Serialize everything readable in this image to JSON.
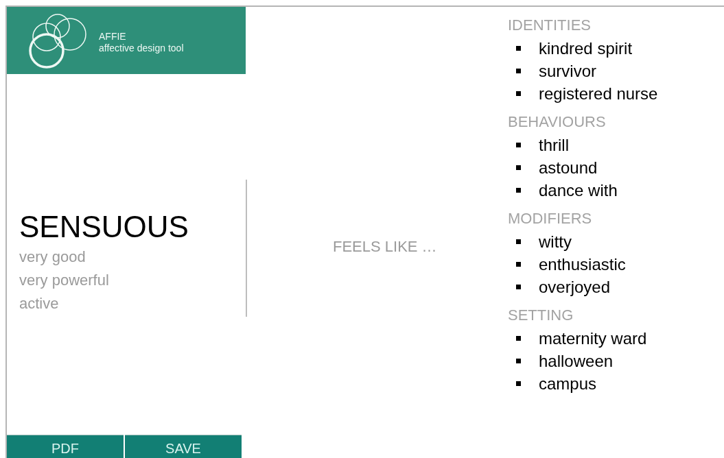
{
  "header": {
    "title": "AFFIE",
    "subtitle": "affective design tool"
  },
  "emotion": {
    "name": "SENSUOUS",
    "qualities": [
      "very good",
      "very powerful",
      "active"
    ]
  },
  "feels_like": "FEELS LIKE …",
  "sections": [
    {
      "title": "IDENTITIES",
      "items": [
        "kindred spirit",
        "survivor",
        "registered nurse"
      ]
    },
    {
      "title": "BEHAVIOURS",
      "items": [
        "thrill",
        "astound",
        "dance with"
      ]
    },
    {
      "title": "MODIFIERS",
      "items": [
        "witty",
        "enthusiastic",
        "overjoyed"
      ]
    },
    {
      "title": "SETTING",
      "items": [
        "maternity ward",
        "halloween",
        "campus"
      ]
    }
  ],
  "buttons": [
    "PDF",
    "SAVE"
  ]
}
